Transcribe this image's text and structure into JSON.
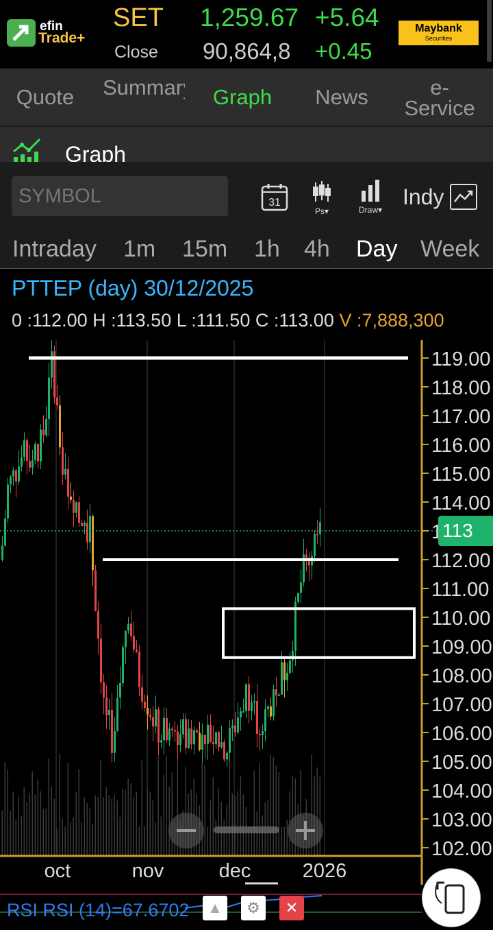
{
  "header": {
    "brand_line1": "efin",
    "brand_line2": "Trade+",
    "index_name": "SET",
    "index_status": "Close",
    "index_value": "1,259.67",
    "index_volume": "90,864,8",
    "index_change": "+5.64",
    "index_change_pct": "+0.45",
    "broker_name": "Maybank",
    "broker_sub": "Securities"
  },
  "tabs": [
    {
      "label": "Quote"
    },
    {
      "label": "Summary"
    },
    {
      "label": "Graph"
    },
    {
      "label": "News"
    },
    {
      "label": "e-Service"
    }
  ],
  "graph_section": {
    "title": "Graph"
  },
  "toolbar": {
    "symbol_placeholder": "SYMBOL",
    "calendar_day": "31",
    "ps_label": "Ps▾",
    "draw_label": "Draw▾",
    "indy_label": "Indy"
  },
  "periods": [
    "Intraday",
    "1m",
    "15m",
    "1h",
    "4h",
    "Day",
    "Week"
  ],
  "active_period": "Day",
  "stock_info": {
    "title": "PTTEP (day) 30/12/2025",
    "open_label": "0 :",
    "open": "112.00",
    "high_label": "H :",
    "high": "113.50",
    "low_label": "L :",
    "low": "111.50",
    "close_label": "C :",
    "close": "113.00",
    "volume_label": "V :",
    "volume": "7,888,300"
  },
  "chart_data": {
    "type": "candlestick",
    "price_axis_labels": [
      "119.00",
      "118.00",
      "117.00",
      "116.00",
      "115.00",
      "114.00",
      "113.00",
      "112.00",
      "111.00",
      "110.00",
      "109.00",
      "108.00",
      "107.00",
      "106.00",
      "105.00",
      "104.00",
      "103.00",
      "102.00"
    ],
    "ylim": [
      101.5,
      119.5
    ],
    "x_labels": [
      "oct",
      "nov",
      "dec",
      "2026"
    ],
    "last_price_tag": "113",
    "last_price": 113.0,
    "annotations": [
      {
        "type": "horizontal_line",
        "price": 119.0
      },
      {
        "type": "horizontal_line",
        "price": 112.0
      },
      {
        "type": "rectangle",
        "price_top": 110.3,
        "price_bottom": 108.6
      }
    ],
    "colors": {
      "up": "#1fb26b",
      "down": "#e5434a",
      "neutral": "#e5a42b",
      "grid": "#2a2a2a",
      "axis": "#c9a227"
    }
  },
  "rsi": {
    "label": "RSI RSI (14)=67.6702"
  },
  "colors": {
    "accent_green": "#3ddc4a",
    "accent_yellow": "#f6c343",
    "link_blue": "#38b6ff",
    "tab_bg": "#2d2d2d"
  }
}
